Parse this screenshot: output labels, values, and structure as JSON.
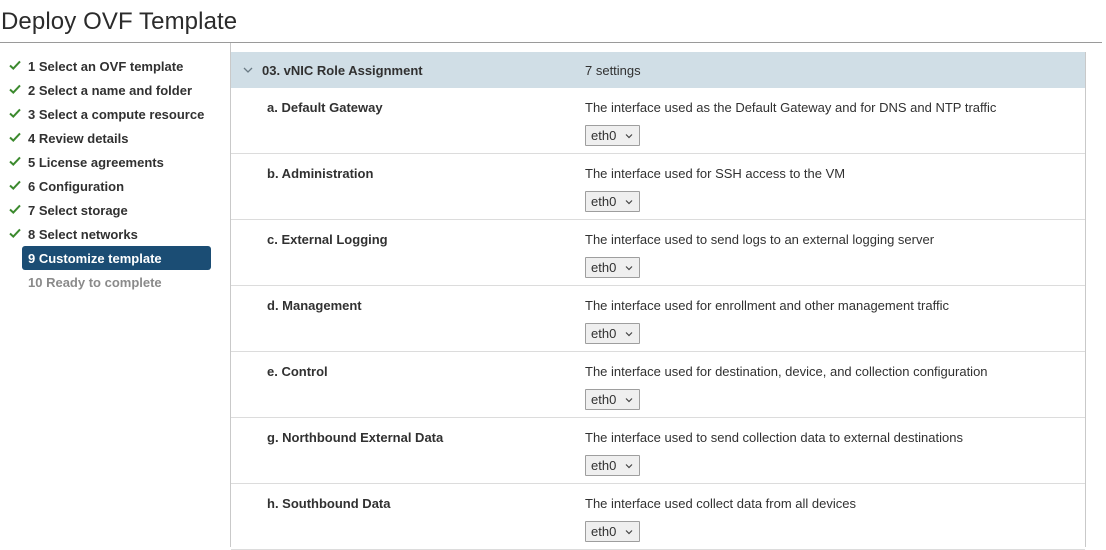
{
  "page": {
    "title": "Deploy OVF Template"
  },
  "steps": [
    {
      "label": "1 Select an OVF template",
      "state": "done"
    },
    {
      "label": "2 Select a name and folder",
      "state": "done"
    },
    {
      "label": "3 Select a compute resource",
      "state": "done"
    },
    {
      "label": "4 Review details",
      "state": "done"
    },
    {
      "label": "5 License agreements",
      "state": "done"
    },
    {
      "label": "6 Configuration",
      "state": "done"
    },
    {
      "label": "7 Select storage",
      "state": "done"
    },
    {
      "label": "8 Select networks",
      "state": "done"
    },
    {
      "label": "9 Customize template",
      "state": "active"
    },
    {
      "label": "10 Ready to complete",
      "state": "disabled"
    }
  ],
  "group": {
    "title": "03. vNIC Role Assignment",
    "count": "7 settings"
  },
  "settings": [
    {
      "label": "a. Default Gateway",
      "description": "The interface used as the Default Gateway and for DNS and NTP traffic",
      "value": "eth0"
    },
    {
      "label": "b. Administration",
      "description": "The interface used for SSH access to the VM",
      "value": "eth0"
    },
    {
      "label": "c. External Logging",
      "description": "The interface used to send logs to an external logging server",
      "value": "eth0"
    },
    {
      "label": "d. Management",
      "description": "The interface used for enrollment and other management traffic",
      "value": "eth0"
    },
    {
      "label": "e. Control",
      "description": "The interface used for destination, device, and collection configuration",
      "value": "eth0"
    },
    {
      "label": "g. Northbound External Data",
      "description": "The interface used to send collection data to external destinations",
      "value": "eth0"
    },
    {
      "label": "h. Southbound Data",
      "description": "The interface used collect data from all devices",
      "value": "eth0"
    }
  ],
  "colors": {
    "check": "#3c8a2e",
    "active_step": "#1b4d74",
    "group_header": "#d0dee6"
  },
  "icons": {
    "step_done": "check-icon",
    "group_toggle": "chevron-down-icon",
    "select": "chevron-down-icon"
  }
}
